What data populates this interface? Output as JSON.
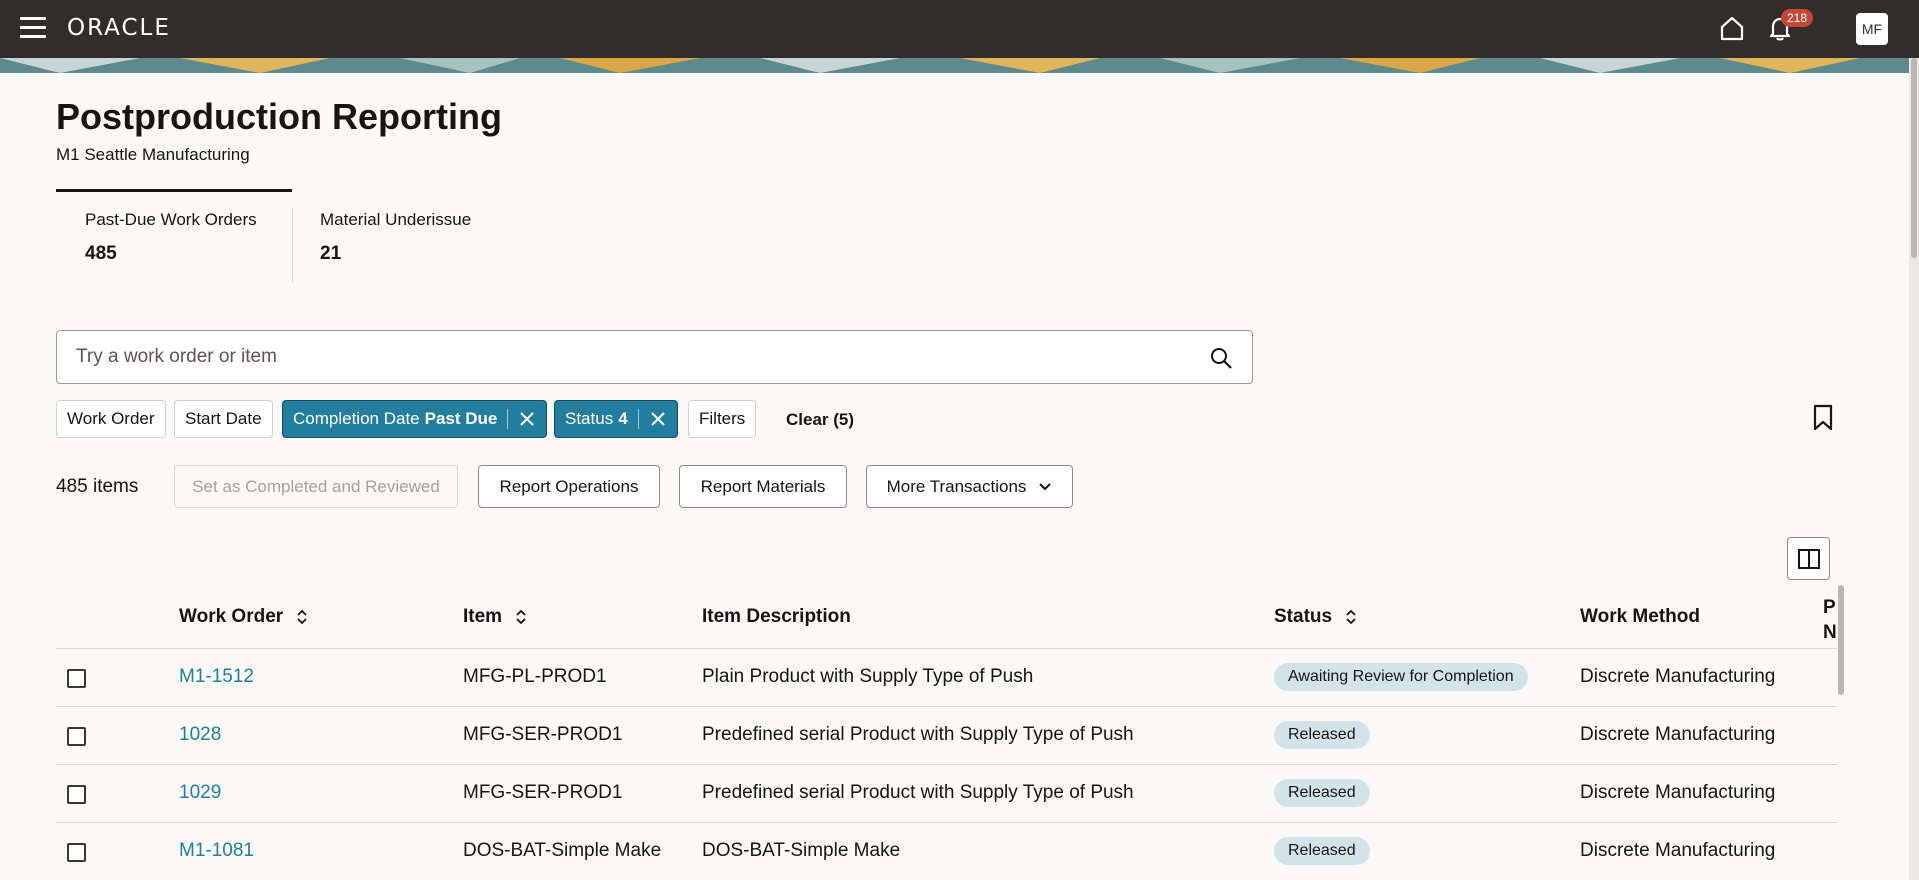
{
  "header": {
    "logo_text": "ORACLE",
    "notification_count": "218",
    "avatar_initials": "MF"
  },
  "page": {
    "title": "Postproduction Reporting",
    "subtitle": "M1 Seattle Manufacturing"
  },
  "metrics": [
    {
      "label": "Past-Due Work Orders",
      "value": "485"
    },
    {
      "label": "Material Underissue",
      "value": "21"
    }
  ],
  "search": {
    "placeholder": "Try a work order or item",
    "value": ""
  },
  "filters": {
    "work_order": "Work Order",
    "start_date": "Start Date",
    "completion_label": "Completion Date",
    "completion_value": "Past Due",
    "status_label": "Status",
    "status_value": "4",
    "filters": "Filters",
    "clear": "Clear (5)"
  },
  "toolbar": {
    "items_count": "485 items",
    "set_completed": "Set as Completed and Reviewed",
    "report_operations": "Report Operations",
    "report_materials": "Report Materials",
    "more_transactions": "More Transactions"
  },
  "table": {
    "columns": {
      "work_order": "Work Order",
      "item": "Item",
      "item_description": "Item Description",
      "status": "Status",
      "work_method": "Work Method",
      "cut_off": "Pr N"
    },
    "rows": [
      {
        "work_order": "M1-1512",
        "item": "MFG-PL-PROD1",
        "item_description": "Plain Product with Supply Type of Push",
        "status": "Awaiting Review for Completion",
        "work_method": "Discrete Manufacturing"
      },
      {
        "work_order": "1028",
        "item": "MFG-SER-PROD1",
        "item_description": "Predefined serial Product with Supply Type of Push",
        "status": "Released",
        "work_method": "Discrete Manufacturing"
      },
      {
        "work_order": "1029",
        "item": "MFG-SER-PROD1",
        "item_description": "Predefined serial Product with Supply Type of Push",
        "status": "Released",
        "work_method": "Discrete Manufacturing"
      },
      {
        "work_order": "M1-1081",
        "item": "DOS-BAT-Simple Make",
        "item_description": "DOS-BAT-Simple Make",
        "status": "Released",
        "work_method": "Discrete Manufacturing"
      }
    ]
  }
}
